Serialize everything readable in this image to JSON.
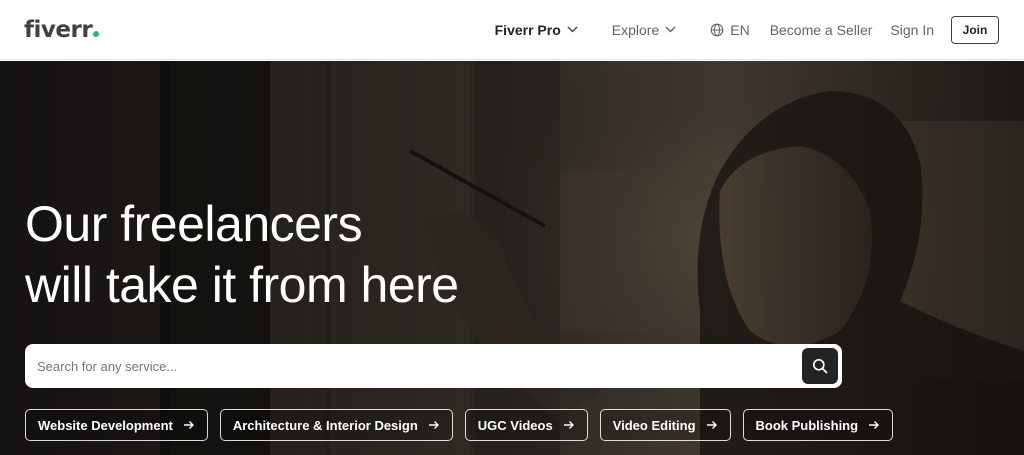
{
  "header": {
    "logo": "fiverr",
    "nav": {
      "pro": "Fiverr Pro",
      "explore": "Explore",
      "lang": "EN",
      "seller": "Become a Seller",
      "signin": "Sign In",
      "join": "Join"
    }
  },
  "hero": {
    "headline_line1": "Our freelancers",
    "headline_line2": "will take it from here",
    "search_placeholder": "Search for any service...",
    "chips": [
      "Website Development",
      "Architecture & Interior Design",
      "UGC Videos",
      "Video Editing",
      "Book Publishing"
    ]
  },
  "colors": {
    "brand_green": "#1dbf73",
    "text_dark": "#222325",
    "text_muted": "#62646a"
  },
  "icons": [
    "chevron-down-icon",
    "globe-icon",
    "search-icon",
    "arrow-right-icon"
  ]
}
